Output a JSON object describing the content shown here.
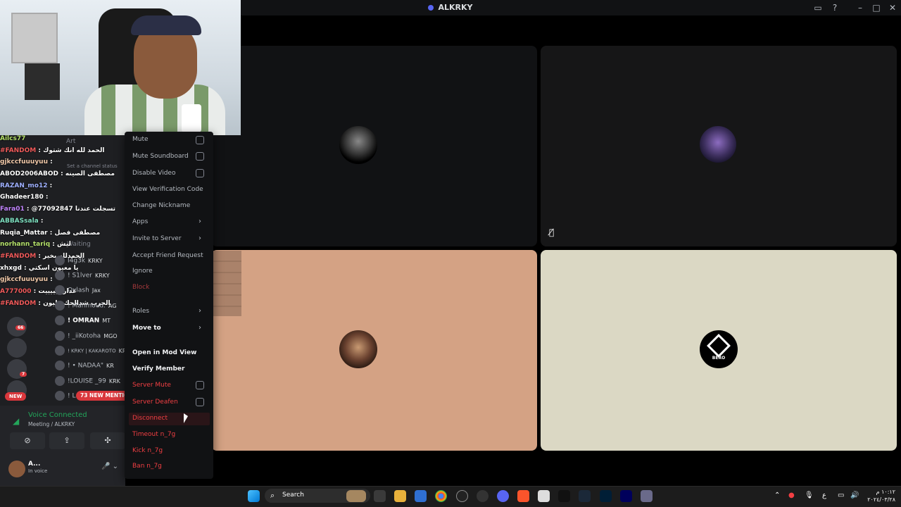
{
  "window": {
    "title": "ALKRKY"
  },
  "context_menu": {
    "items": [
      {
        "label": "Mute",
        "kind": "checkbox",
        "style": "normal"
      },
      {
        "label": "Mute Soundboard",
        "kind": "checkbox",
        "style": "normal"
      },
      {
        "label": "Disable Video",
        "kind": "checkbox",
        "style": "normal"
      },
      {
        "label": "View Verification Code",
        "kind": "plain",
        "style": "normal"
      },
      {
        "label": "Change Nickname",
        "kind": "plain",
        "style": "normal"
      },
      {
        "label": "Apps",
        "kind": "submenu",
        "style": "normal"
      },
      {
        "label": "Invite to Server",
        "kind": "submenu",
        "style": "normal"
      },
      {
        "label": "Accept Friend Request",
        "kind": "plain",
        "style": "normal"
      },
      {
        "label": "Ignore",
        "kind": "plain",
        "style": "normal"
      },
      {
        "label": "Block",
        "kind": "plain",
        "style": "danger-dim"
      },
      {
        "label": "Roles",
        "kind": "submenu",
        "style": "normal"
      },
      {
        "label": "Move to",
        "kind": "submenu",
        "style": "bright"
      },
      {
        "label": "Open in Mod View",
        "kind": "plain",
        "style": "bright"
      },
      {
        "label": "Verify Member",
        "kind": "plain",
        "style": "bright"
      },
      {
        "label": "Server Mute",
        "kind": "checkbox",
        "style": "danger"
      },
      {
        "label": "Server Deafen",
        "kind": "checkbox",
        "style": "danger"
      },
      {
        "label": "Disconnect",
        "kind": "plain",
        "style": "danger"
      },
      {
        "label": "Timeout n_7g",
        "kind": "plain",
        "style": "danger"
      },
      {
        "label": "Kick n_7g",
        "kind": "plain",
        "style": "danger"
      },
      {
        "label": "Ban n_7g",
        "kind": "plain",
        "style": "danger"
      }
    ]
  },
  "chat": {
    "lines": [
      {
        "nick": "Ailcs77",
        "text": ""
      },
      {
        "nick": "#FANDOM",
        "text": "الحمد لله انك شتوك"
      },
      {
        "nick": "gjkccfuuuyuu",
        "text": ""
      },
      {
        "nick": "ABOD2006ABOD",
        "text": "مصطفى الصينه"
      },
      {
        "nick": "RAZAN_mo12",
        "text": ""
      },
      {
        "nick": "Ghadeer180",
        "text": ""
      },
      {
        "nick": "Fara01",
        "text": "@77092847 تسجلت عندنا"
      },
      {
        "nick": "ABBASsala",
        "text": ""
      },
      {
        "nick": "Ruqia_Mattar",
        "text": "مصطفى فصل"
      },
      {
        "nick": "norhann_tariq",
        "text": "ليش"
      },
      {
        "nick": "#FANDOM",
        "text": "الحمدلله بخير"
      },
      {
        "nick": "xhxgd",
        "text": "يا معيون اسكتي"
      },
      {
        "nick": "gjkccfuuuyuu",
        "text": ""
      },
      {
        "nick": "A777000",
        "text": "غداريييييييت"
      },
      {
        "nick": "#FANDOM",
        "text": "الحرب شدالحك مليون"
      }
    ]
  },
  "channel_overlay": {
    "category": "Art",
    "status": "Set a channel status",
    "waiting": "Waiting"
  },
  "members": [
    {
      "name": "I4g3k",
      "tag": "KRKY"
    },
    {
      "name": "! S1lver",
      "tag": "KRKY"
    },
    {
      "name": "Ovlash",
      "tag": "Jax"
    },
    {
      "name": "! Mahmoud.",
      "tag": "AG"
    },
    {
      "name": "! OMRAN",
      "tag": "MT"
    },
    {
      "name": "! _iiKotoha",
      "tag": "MGO"
    },
    {
      "name": "! KRKY | KAKAROTO",
      "tag": "KRKY"
    },
    {
      "name": "! • NADAA\"",
      "tag": "KR"
    },
    {
      "name": "!LOUISE _99",
      "tag": "KRK"
    },
    {
      "name": "! L",
      "tag": ""
    }
  ],
  "badges": {
    "mentions": "73 NEW MENTIONS",
    "new": "NEW",
    "count_66": "66",
    "count_7": "7"
  },
  "voice": {
    "status": "Voice Connected",
    "channel": "Meeting / ALKRKY"
  },
  "user": {
    "name": "A...",
    "status": "In voice"
  },
  "tiles": [
    {
      "id": "tile-a",
      "bg": "#111214"
    },
    {
      "id": "tile-b",
      "bg": "#161617"
    },
    {
      "id": "tile-c",
      "bg": "#d4a284"
    },
    {
      "id": "tile-d",
      "bg": "#dbd8c4",
      "avatar_text": "BERO"
    }
  ],
  "taskbar": {
    "search_placeholder": "Search",
    "clock_time": "١٠:١٢ م",
    "clock_date": "٢٠٢٤/٠٣/٢٨",
    "lang": "ع"
  },
  "colors": {
    "accent": "#5865f2",
    "danger": "#f23f43",
    "voice_green": "#23a55a",
    "mention_red": "#da373c"
  }
}
